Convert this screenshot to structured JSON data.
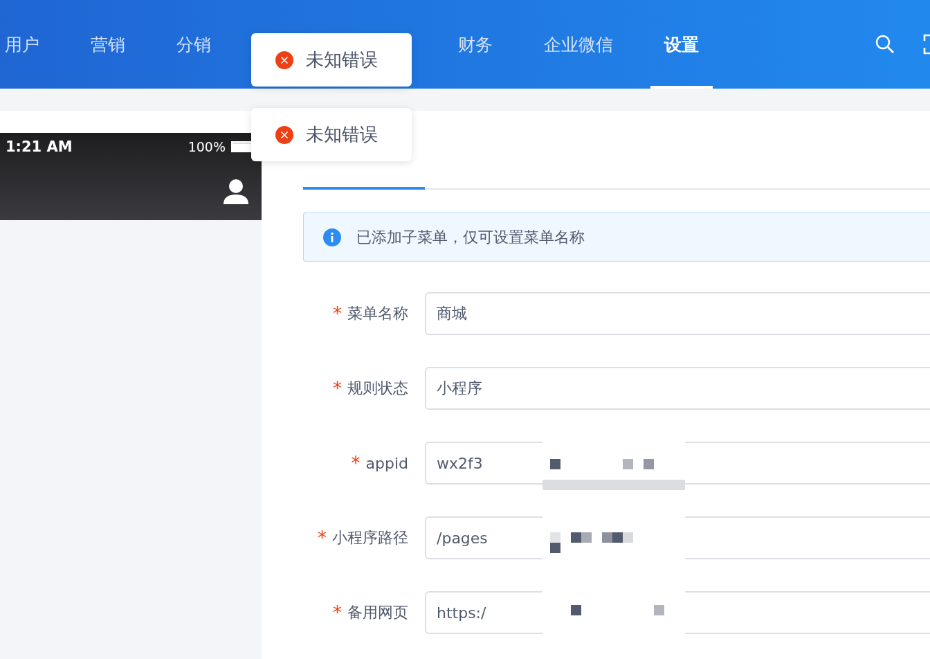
{
  "nav": {
    "items": [
      {
        "label": "用户",
        "selected": false
      },
      {
        "label": "营销",
        "selected": false
      },
      {
        "label": "分销",
        "selected": false
      },
      {
        "label": "财务",
        "selected": false
      },
      {
        "label": "企业微信",
        "selected": false
      },
      {
        "label": "设置",
        "selected": true
      }
    ]
  },
  "toasts": [
    {
      "kind": "error",
      "text": "未知错误"
    },
    {
      "kind": "error",
      "text": "未知错误"
    }
  ],
  "phone": {
    "time": "1:21 AM",
    "battery": "100%"
  },
  "tabs": [
    {
      "selected": true
    }
  ],
  "alert": {
    "kind": "info",
    "text": "已添加子菜单，仅可设置菜单名称"
  },
  "form": [
    {
      "label": "菜单名称",
      "required_mark": "*",
      "value": "商城"
    },
    {
      "label": "规则状态",
      "required_mark": "*",
      "value": "小程序"
    },
    {
      "label": "appid",
      "required_mark": "*",
      "value": "wx2f3"
    },
    {
      "label": "小程序路径",
      "required_mark": "*",
      "value": "/pages"
    },
    {
      "label": "备用网页",
      "required_mark": "*",
      "value": "https:/"
    }
  ]
}
